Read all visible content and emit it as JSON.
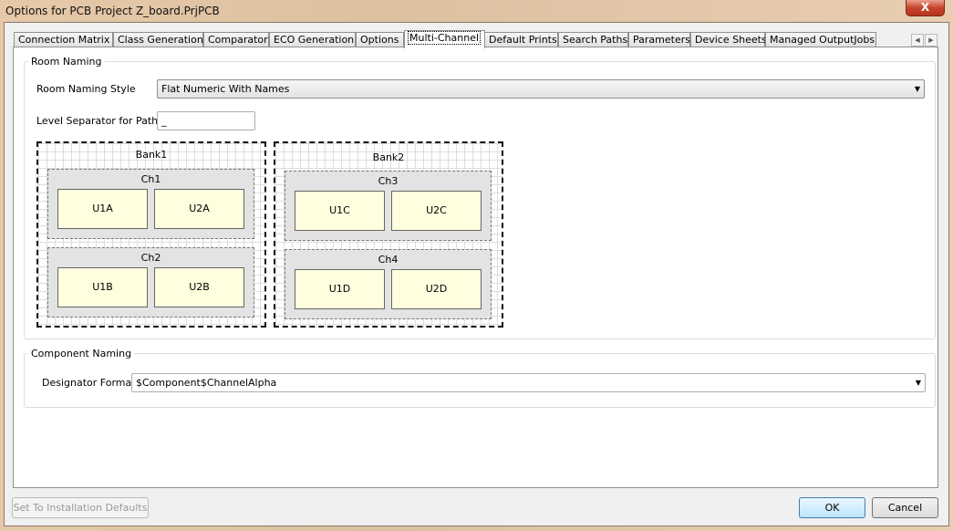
{
  "window": {
    "title": "Options for PCB Project Z_board.PrjPCB",
    "close_label": "X"
  },
  "tabs": [
    "Connection Matrix",
    "Class Generation",
    "Comparator",
    "ECO Generation",
    "Options",
    "Multi-Channel",
    "Default Prints",
    "Search Paths",
    "Parameters",
    "Device Sheets",
    "Managed OutputJobs"
  ],
  "active_tab": "Multi-Channel",
  "room_naming": {
    "group_label": "Room Naming",
    "style_label": "Room Naming Style",
    "style_value": "Flat Numeric With Names",
    "separator_label": "Level Separator for Paths",
    "separator_value": "_"
  },
  "diagram": {
    "banks": [
      {
        "label": "Bank1",
        "channels": [
          {
            "label": "Ch1",
            "parts": [
              "U1A",
              "U2A"
            ]
          },
          {
            "label": "Ch2",
            "parts": [
              "U1B",
              "U2B"
            ]
          }
        ]
      },
      {
        "label": "Bank2",
        "channels": [
          {
            "label": "Ch3",
            "parts": [
              "U1C",
              "U2C"
            ]
          },
          {
            "label": "Ch4",
            "parts": [
              "U1D",
              "U2D"
            ]
          }
        ]
      }
    ]
  },
  "component_naming": {
    "group_label": "Component Naming",
    "format_label": "Designator Format",
    "format_value": "$Component$ChannelAlpha"
  },
  "buttons": {
    "defaults": "Set To Installation Defaults",
    "ok": "OK",
    "cancel": "Cancel"
  }
}
